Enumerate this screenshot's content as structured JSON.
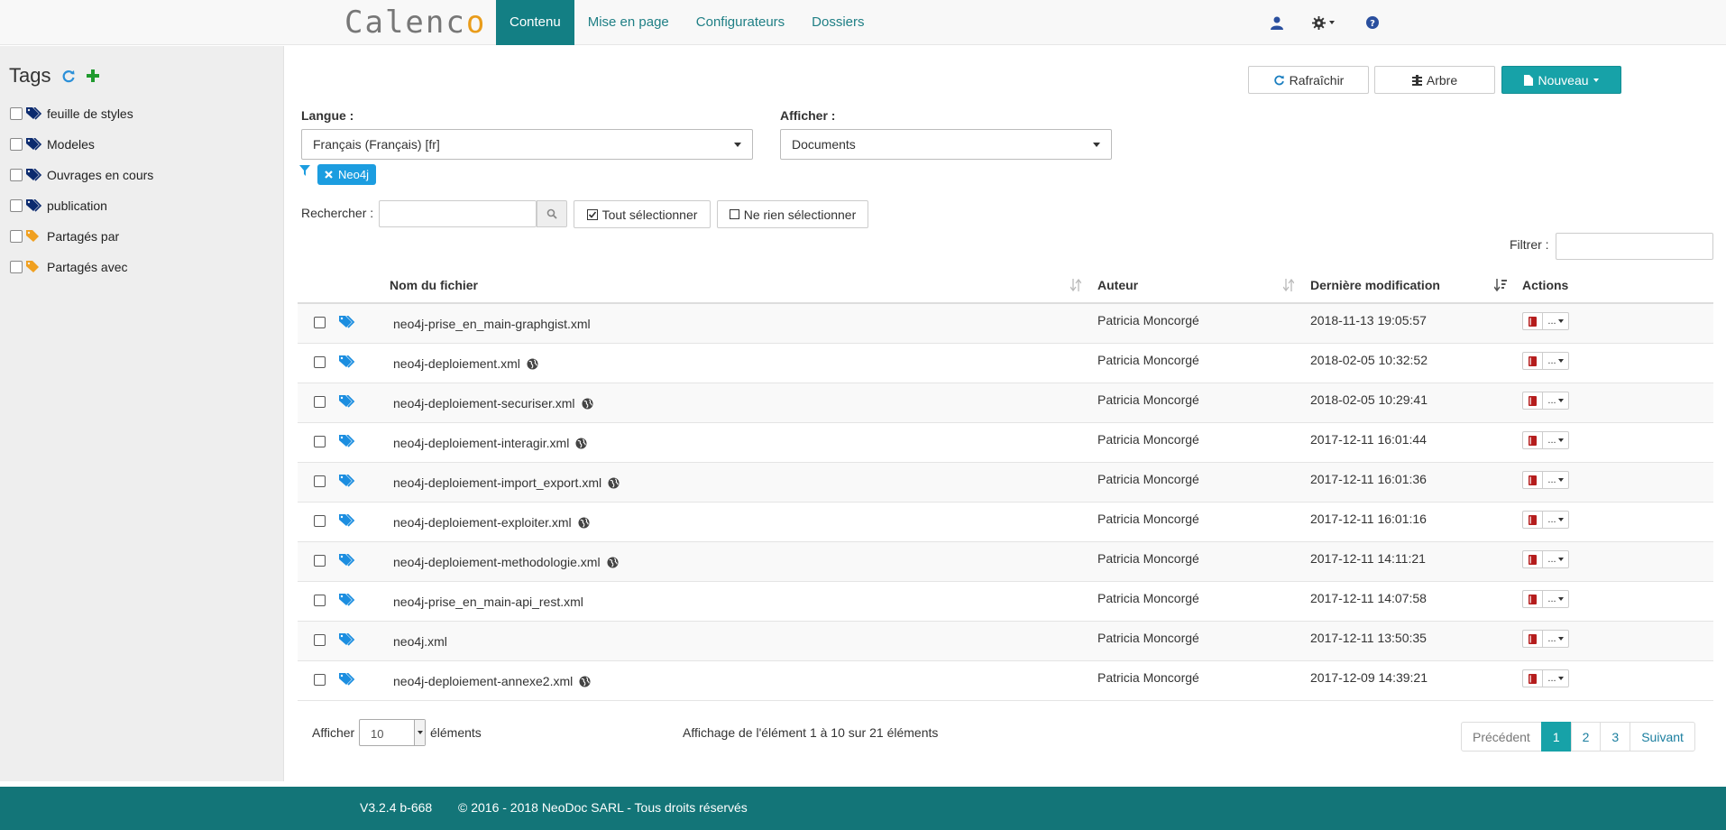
{
  "brand": {
    "prefix": "Calenc",
    "accent": "o"
  },
  "nav": {
    "tabs": [
      {
        "label": "Contenu",
        "active": true
      },
      {
        "label": "Mise en page"
      },
      {
        "label": "Configurateurs"
      },
      {
        "label": "Dossiers"
      }
    ],
    "icons": [
      "user-icon",
      "gear-icon",
      "help-icon"
    ]
  },
  "sidebar": {
    "title": "Tags",
    "tags": [
      {
        "label": "feuille de styles",
        "color": "#0b2a6e"
      },
      {
        "label": "Modeles",
        "color": "#0b2a6e"
      },
      {
        "label": "Ouvrages en cours",
        "color": "#0b2a6e"
      },
      {
        "label": "publication",
        "color": "#0b2a6e"
      },
      {
        "label": "Partagés par",
        "color": "#f0a020"
      },
      {
        "label": "Partagés avec",
        "color": "#f0a020"
      }
    ]
  },
  "toolbar": {
    "refresh": "Rafraîchir",
    "tree": "Arbre",
    "new": "Nouveau"
  },
  "langue": {
    "label": "Langue :",
    "value": "Français (Français) [fr]"
  },
  "afficher": {
    "label": "Afficher :",
    "value": "Documents"
  },
  "filter_chip": "Neo4j",
  "search": {
    "label": "Rechercher :",
    "value": "",
    "select_all": "Tout sélectionner",
    "select_none": "Ne rien sélectionner"
  },
  "filtrer": {
    "label": "Filtrer :",
    "value": ""
  },
  "table": {
    "headers": {
      "name": "Nom du fichier",
      "author": "Auteur",
      "date": "Dernière modification",
      "actions": "Actions"
    },
    "rows": [
      {
        "name": "neo4j-prise_en_main-graphgist.xml",
        "public": false,
        "author": "Patricia Moncorgé",
        "date": "2018-11-13 19:05:57"
      },
      {
        "name": "neo4j-deploiement.xml",
        "public": true,
        "author": "Patricia Moncorgé",
        "date": "2018-02-05 10:32:52"
      },
      {
        "name": "neo4j-deploiement-securiser.xml",
        "public": true,
        "author": "Patricia Moncorgé",
        "date": "2018-02-05 10:29:41"
      },
      {
        "name": "neo4j-deploiement-interagir.xml",
        "public": true,
        "author": "Patricia Moncorgé",
        "date": "2017-12-11 16:01:44"
      },
      {
        "name": "neo4j-deploiement-import_export.xml",
        "public": true,
        "author": "Patricia Moncorgé",
        "date": "2017-12-11 16:01:36"
      },
      {
        "name": "neo4j-deploiement-exploiter.xml",
        "public": true,
        "author": "Patricia Moncorgé",
        "date": "2017-12-11 16:01:16"
      },
      {
        "name": "neo4j-deploiement-methodologie.xml",
        "public": true,
        "author": "Patricia Moncorgé",
        "date": "2017-12-11 14:11:21"
      },
      {
        "name": "neo4j-prise_en_main-api_rest.xml",
        "public": false,
        "author": "Patricia Moncorgé",
        "date": "2017-12-11 14:07:58"
      },
      {
        "name": "neo4j.xml",
        "public": false,
        "author": "Patricia Moncorgé",
        "date": "2017-12-11 13:50:35"
      },
      {
        "name": "neo4j-deploiement-annexe2.xml",
        "public": true,
        "author": "Patricia Moncorgé",
        "date": "2017-12-09 14:39:21"
      }
    ],
    "more_label": "..."
  },
  "length": {
    "prefix": "Afficher",
    "value": "10",
    "suffix": "éléments"
  },
  "info": "Affichage de l'élément 1 à 10 sur 21 éléments",
  "pagination": {
    "previous": "Précédent",
    "pages": [
      "1",
      "2",
      "3"
    ],
    "current": "1",
    "next": "Suivant"
  },
  "footer": {
    "version": "V3.2.4 b-668",
    "copyright": "© 2016 - 2018 NeoDoc SARL - Tous droits réservés"
  },
  "colors": {
    "accent": "#17a2a8",
    "nav_active": "#137f84",
    "footer": "#137578",
    "link": "#1f7f85"
  }
}
